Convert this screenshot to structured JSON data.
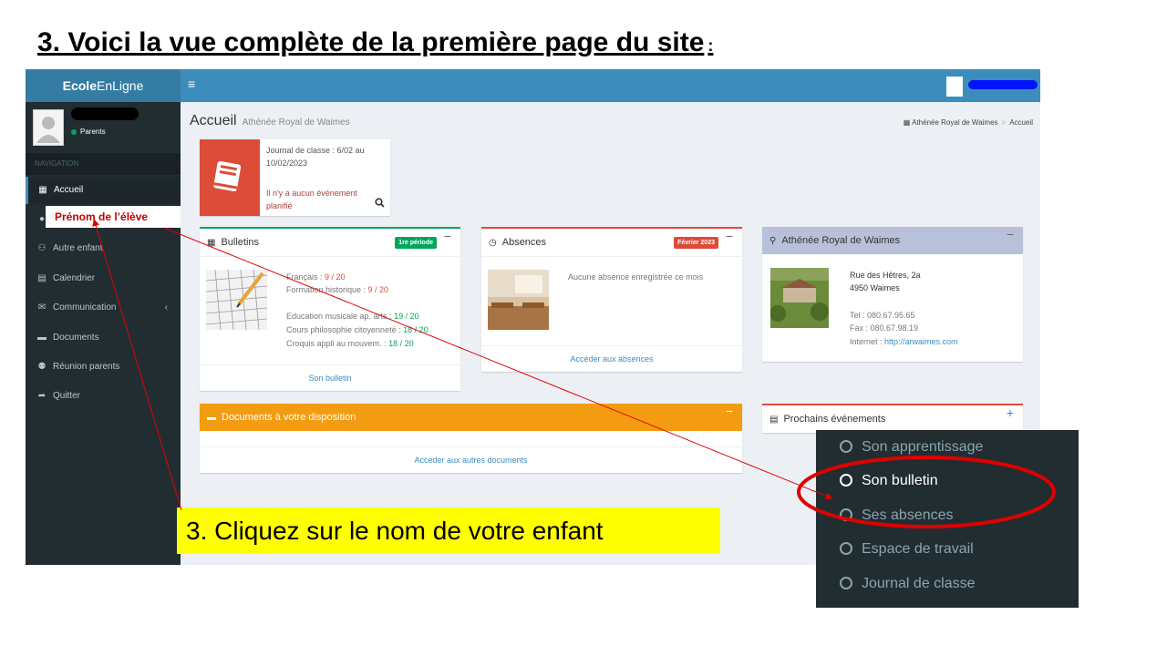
{
  "slide": {
    "title": "3. Voici la vue complète de la première page du site",
    "title_colon": ":"
  },
  "app": {
    "logo_bold": "Ecole",
    "logo_rest": "EnLigne",
    "user_status": "Parents",
    "nav_header": "NAVIGATION",
    "nav": [
      {
        "label": "Accueil",
        "icon": "grid-icon"
      },
      {
        "label": "Autre enfant",
        "icon": "user-plus-icon"
      },
      {
        "label": "Calendrier",
        "icon": "calendar-icon"
      },
      {
        "label": "Communication",
        "icon": "envelope-icon"
      },
      {
        "label": "Documents",
        "icon": "folder-icon"
      },
      {
        "label": "Réunion parents",
        "icon": "users-icon"
      },
      {
        "label": "Quitter",
        "icon": "share-icon"
      }
    ],
    "page_title": "Accueil",
    "page_subtitle": "Athénée Royal de Waimes",
    "breadcrumb": [
      "Athénée Royal de Waimes",
      "Accueil"
    ]
  },
  "journal": {
    "line1": "Journal de classe : 6/02 au 10/02/2023",
    "line2": "Il n'y a aucun événement planifié"
  },
  "bulletins": {
    "title": "Bulletins",
    "badge": "1re période",
    "grades": [
      {
        "subject": "Français : ",
        "score": "9 / 20",
        "status": "red"
      },
      {
        "subject": "Formation historique : ",
        "score": "9 / 20",
        "status": "red"
      },
      {
        "subject": "Education musicale ap. arts : ",
        "score": "19 / 20",
        "status": "green"
      },
      {
        "subject": "Cours philosophie citoyenneté : ",
        "score": "18 / 20",
        "status": "green"
      },
      {
        "subject": "Croquis appli au mouvem. : ",
        "score": "18 / 20",
        "status": "green"
      }
    ],
    "footer": "Son bulletin"
  },
  "absences": {
    "title": "Absences",
    "badge": "Février 2023",
    "text": "Aucune absence enregistrée ce mois",
    "footer": "Accéder aux absences"
  },
  "school": {
    "title": "Athénée Royal de Waimes",
    "street": "Rue des Hêtres, 2a",
    "city": "4950 Waimes",
    "tel": "Tel : 080.67.95.65",
    "fax": "Fax : 080.67.98.19",
    "internet_label": "Internet : ",
    "internet_link": "http://arwaimes.com"
  },
  "documents": {
    "title": "Documents à votre disposition",
    "footer": "Accéder aux autres documents"
  },
  "events": {
    "title": "Prochains événements"
  },
  "hint": "Prénom de l’élève",
  "callout": "3. Cliquez sur le nom de votre enfant",
  "popup": [
    {
      "label": "Son apprentissage"
    },
    {
      "label": "Son bulletin"
    },
    {
      "label": "Ses absences"
    },
    {
      "label": "Espace de travail"
    },
    {
      "label": "Journal de classe"
    }
  ],
  "colors": {
    "topbar": "#3c8dbc",
    "sidebar": "#222d32",
    "badge_green": "#00a65a",
    "badge_red": "#dd4b39",
    "documents_header": "#f39c12",
    "school_header": "#b8c1d9",
    "annotation_red": "#e00000",
    "callout_yellow": "#ffff00"
  }
}
